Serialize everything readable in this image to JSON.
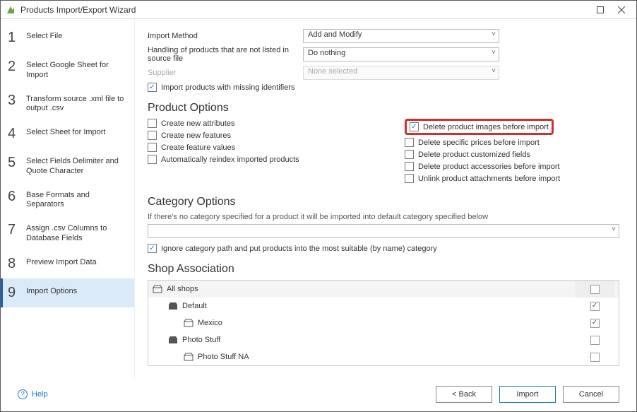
{
  "window": {
    "title": "Products Import/Export Wizard",
    "maximize_icon": "maximize-icon",
    "close_icon": "close-icon"
  },
  "steps": [
    {
      "num": "1",
      "label": "Select File"
    },
    {
      "num": "2",
      "label": "Select Google Sheet for Import"
    },
    {
      "num": "3",
      "label": "Transform source .xml file to output .csv"
    },
    {
      "num": "4",
      "label": "Select Sheet for Import"
    },
    {
      "num": "5",
      "label": "Select Fields Delimiter and Quote Character"
    },
    {
      "num": "6",
      "label": "Base Formats and Separators"
    },
    {
      "num": "7",
      "label": "Assign .csv Columns to Database Fields"
    },
    {
      "num": "8",
      "label": "Preview Import Data"
    },
    {
      "num": "9",
      "label": "Import Options"
    }
  ],
  "active_step_index": 8,
  "import_method": {
    "label": "Import Method",
    "value": "Add and Modify"
  },
  "handling": {
    "label": "Handling of products that are not listed in source file",
    "value": "Do nothing"
  },
  "supplier": {
    "label": "Supplier",
    "value": "None selected"
  },
  "import_missing": {
    "checked": true,
    "label": "Import products with missing identifiers"
  },
  "sections": {
    "product_options": "Product Options",
    "category_options": "Category Options",
    "shop_association": "Shop Association"
  },
  "product_opts_left": [
    {
      "label": "Create new attributes",
      "checked": false
    },
    {
      "label": "Create new features",
      "checked": false
    },
    {
      "label": "Create feature values",
      "checked": false
    },
    {
      "label": "Automatically reindex imported products",
      "checked": false
    }
  ],
  "product_opts_right": [
    {
      "label": "Delete product images before import",
      "checked": true,
      "highlight": true
    },
    {
      "label": "Delete specific prices before import",
      "checked": false
    },
    {
      "label": "Delete product customized fields",
      "checked": false
    },
    {
      "label": "Delete product accessories before import",
      "checked": false
    },
    {
      "label": "Unlink product attachments before import",
      "checked": false
    }
  ],
  "category_desc": "If there's no category specified for a product it will be imported into default category specified below",
  "ignore_category": {
    "checked": true,
    "label": "Ignore category path and put products into the most suitable (by name) category"
  },
  "shops": [
    {
      "label": "All shops",
      "indent": 0,
      "checked": false,
      "header": true
    },
    {
      "label": "Default",
      "indent": 1,
      "checked": true
    },
    {
      "label": "Mexico",
      "indent": 2,
      "checked": true
    },
    {
      "label": "Photo Stuff",
      "indent": 1,
      "checked": false
    },
    {
      "label": "Photo Stuff NA",
      "indent": 2,
      "checked": false
    }
  ],
  "footer": {
    "help": "Help",
    "back": "< Back",
    "import": "Import",
    "cancel": "Cancel"
  }
}
